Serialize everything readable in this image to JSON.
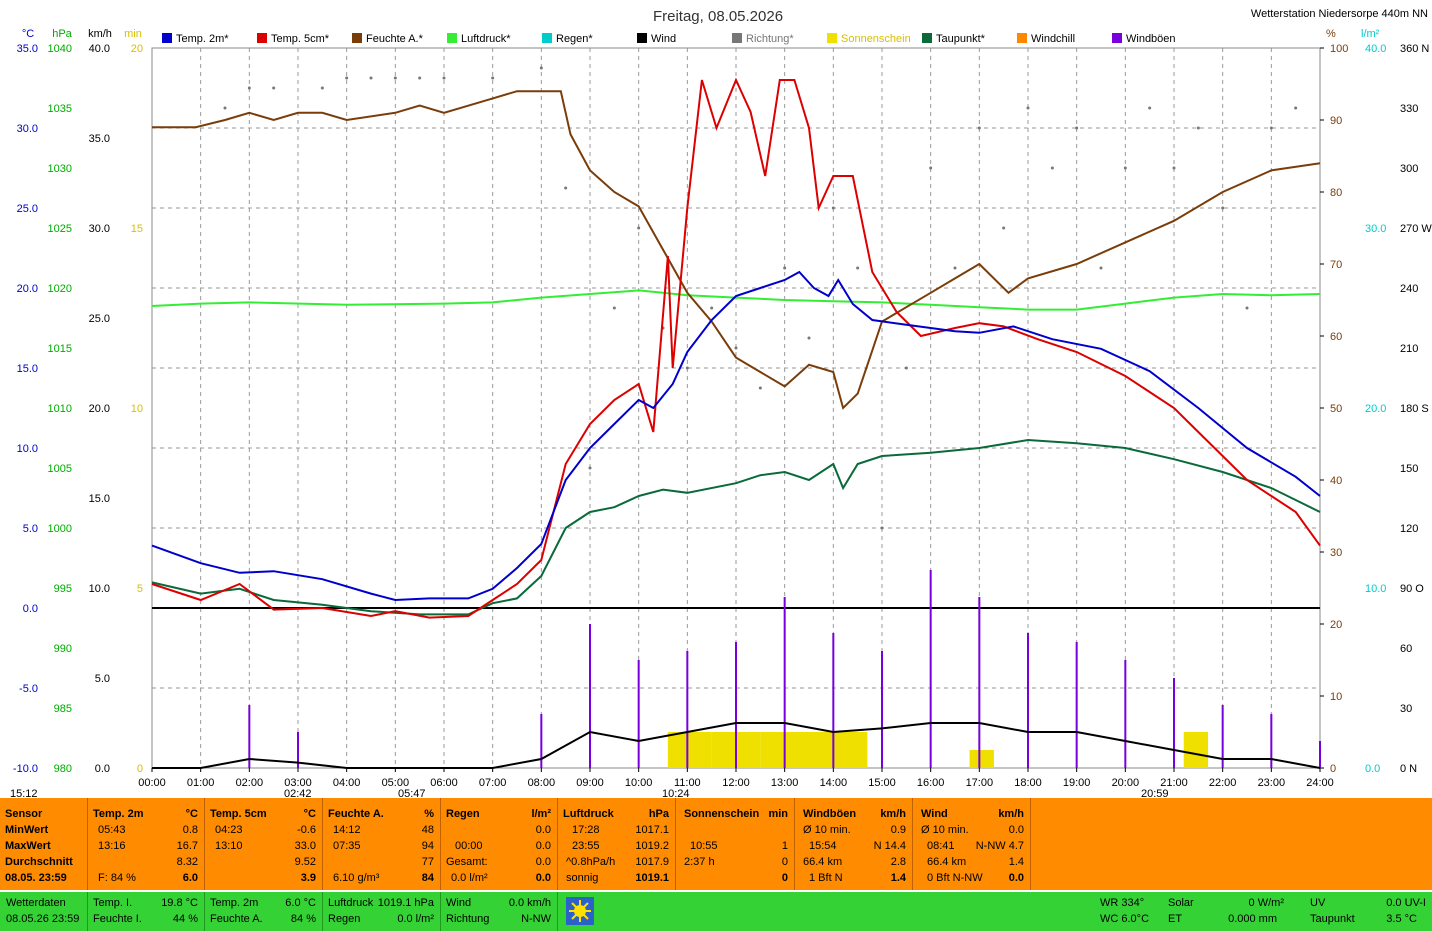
{
  "header": {
    "title": "Freitag, 08.05.2026",
    "station": "Wetterstation Niedersorpe 440m NN",
    "markers": {
      "start": "15:12",
      "min1": "02:42",
      "min2": "05:47",
      "noon": "10:24",
      "end": "20:59"
    }
  },
  "colors": {
    "temp2m": "#0000cc",
    "temp5cm": "#dd0000",
    "feuchte": "#7a3d0a",
    "luftdruck": "#33ee33",
    "regen": "#00cccc",
    "wind": "#000000",
    "richtung": "#777777",
    "sonne": "#f0e000",
    "taupunkt": "#0a6a3a",
    "windchill": "#ff8800",
    "windboeen": "#7700dd",
    "panel": "#ff8c00",
    "panel2": "#35d235"
  },
  "chart_data": {
    "type": "line",
    "title": "Freitag, 08.05.2026",
    "x_range": [
      0,
      24
    ],
    "x_tick_labels": [
      "00:00",
      "01:00",
      "02:00",
      "03:00",
      "04:00",
      "05:00",
      "06:00",
      "07:00",
      "08:00",
      "09:00",
      "10:00",
      "11:00",
      "12:00",
      "13:00",
      "14:00",
      "15:00",
      "16:00",
      "17:00",
      "18:00",
      "19:00",
      "20:00",
      "21:00",
      "22:00",
      "23:00",
      "24:00"
    ],
    "axes": {
      "left": [
        {
          "unit": "°C",
          "range": [
            -10,
            35
          ],
          "ticks": [
            "35.0",
            "30.0",
            "25.0",
            "20.0",
            "15.0",
            "10.0",
            "5.0",
            "0.0",
            "-5.0",
            "-10.0"
          ],
          "color": "#0000cc"
        },
        {
          "unit": "hPa",
          "range": [
            980,
            1040
          ],
          "ticks": [
            "1040",
            "1035",
            "1030",
            "1025",
            "1020",
            "1015",
            "1010",
            "1005",
            "1000",
            "995",
            "990",
            "985",
            "980"
          ],
          "color": "#00aa00"
        },
        {
          "unit": "km/h",
          "range": [
            0,
            40
          ],
          "ticks": [
            "40.0",
            "35.0",
            "30.0",
            "25.0",
            "20.0",
            "15.0",
            "10.0",
            "5.0",
            "0.0"
          ],
          "color": "#000000"
        },
        {
          "unit": "min",
          "range": [
            0,
            20
          ],
          "ticks": [
            "20",
            "15",
            "10",
            "5",
            "0"
          ],
          "color": "#d8c000"
        }
      ],
      "right": [
        {
          "unit": "%",
          "range": [
            0,
            100
          ],
          "ticks": [
            "100",
            "90",
            "80",
            "70",
            "60",
            "50",
            "40",
            "30",
            "20",
            "10",
            "0"
          ],
          "color": "#7a3d0a"
        },
        {
          "unit": "l/m²",
          "range": [
            0,
            40
          ],
          "ticks": [
            "40.0",
            "30.0",
            "20.0",
            "10.0",
            "0.0"
          ],
          "color": "#00cccc"
        },
        {
          "unit": "",
          "range": [
            0,
            360
          ],
          "ticks": [
            "360 N",
            "330",
            "300",
            "270 W",
            "240",
            "210",
            "180 S",
            "150",
            "120",
            "90 O",
            "60",
            "30",
            "0 N"
          ],
          "color": "#000000"
        }
      ]
    },
    "legend": [
      "Temp. 2m*",
      "Temp. 5cm*",
      "Feuchte A.*",
      "Luftdruck*",
      "Regen*",
      "Wind",
      "Richtung*",
      "Sonnenschein",
      "Taupunkt*",
      "Windchill",
      "Windböen"
    ],
    "series": [
      {
        "name": "Temp. 2m*",
        "unit": "°C",
        "x": [
          0,
          1,
          1.8,
          2.5,
          3.5,
          4.5,
          5.0,
          5.7,
          6.5,
          7.0,
          7.5,
          8.0,
          8.5,
          9.0,
          9.5,
          10.0,
          10.3,
          10.7,
          11.0,
          11.5,
          12.0,
          12.5,
          13.0,
          13.3,
          13.6,
          13.9,
          14.1,
          14.4,
          14.8,
          15.5,
          16.5,
          17.0,
          17.7,
          18.5,
          19.5,
          20.5,
          21.5,
          22.5,
          23.5,
          24.0
        ],
        "values": [
          3.9,
          2.8,
          2.2,
          2.3,
          1.8,
          0.9,
          0.5,
          0.6,
          0.6,
          1.2,
          2.5,
          4.0,
          8.0,
          10.0,
          11.5,
          13.0,
          12.5,
          14.0,
          16.0,
          18.0,
          19.5,
          20.0,
          20.5,
          21.0,
          20.0,
          19.5,
          20.5,
          19.0,
          18.0,
          17.7,
          17.3,
          17.2,
          17.6,
          16.8,
          16.2,
          14.8,
          12.5,
          10.0,
          8.2,
          7.0
        ]
      },
      {
        "name": "Temp. 5cm*",
        "unit": "°C",
        "x": [
          0,
          1,
          1.8,
          2.5,
          3.5,
          4.5,
          5.0,
          5.7,
          6.5,
          7.0,
          7.5,
          8.0,
          8.5,
          9.0,
          9.5,
          10.0,
          10.3,
          10.6,
          10.7,
          11.0,
          11.3,
          11.6,
          12.0,
          12.3,
          12.6,
          12.9,
          13.2,
          13.5,
          13.7,
          14.0,
          14.4,
          14.8,
          15.3,
          15.8,
          16.5,
          17.0,
          17.5,
          18.2,
          19.0,
          20.0,
          21.0,
          21.5,
          22.5,
          23.5,
          24.0
        ],
        "values": [
          1.5,
          0.5,
          1.5,
          -0.1,
          0.0,
          -0.5,
          -0.2,
          -0.6,
          -0.5,
          0.5,
          1.5,
          3.0,
          9.0,
          11.5,
          13.0,
          14.0,
          11.0,
          22.0,
          15.0,
          25.0,
          33.0,
          30.0,
          33.0,
          31.0,
          27.0,
          33.0,
          33.0,
          30.0,
          25.0,
          27.0,
          27.0,
          21.0,
          18.5,
          17.0,
          17.5,
          17.8,
          17.6,
          16.8,
          16.0,
          14.5,
          12.5,
          11.0,
          8.0,
          6.0,
          3.9
        ]
      },
      {
        "name": "Feuchte A.*",
        "unit": "%",
        "x": [
          0,
          0.9,
          1.5,
          2.0,
          2.5,
          3.0,
          3.5,
          4.0,
          5.0,
          5.5,
          6.0,
          7.0,
          7.5,
          8.0,
          8.4,
          8.6,
          9.0,
          9.5,
          10.0,
          10.5,
          11.0,
          11.5,
          12.0,
          12.5,
          13.0,
          13.5,
          14.0,
          14.2,
          14.5,
          14.8,
          15.0,
          15.5,
          16.0,
          16.5,
          17.0,
          17.6,
          18.0,
          19.0,
          20.0,
          21.0,
          22.0,
          23.0,
          24.0
        ],
        "values": [
          89,
          89,
          90,
          91,
          90,
          91,
          91,
          90,
          91,
          92,
          91,
          93,
          94,
          94,
          94,
          88,
          83,
          80,
          78,
          72,
          66,
          62,
          57,
          55,
          53,
          56,
          55,
          50,
          52,
          58,
          62,
          64,
          66,
          68,
          70,
          66,
          68,
          70,
          73,
          76,
          80,
          83,
          84
        ]
      },
      {
        "name": "Luftdruck*",
        "unit": "hPa",
        "x": [
          0,
          1,
          2,
          4,
          6,
          7,
          8,
          9,
          10,
          10.5,
          11,
          12,
          13,
          14,
          15,
          16,
          17,
          18,
          19,
          20,
          21,
          22,
          23,
          24
        ],
        "values": [
          1018.5,
          1018.7,
          1018.8,
          1018.6,
          1018.7,
          1018.8,
          1019.2,
          1019.5,
          1019.8,
          1019.6,
          1019.4,
          1019.2,
          1019.0,
          1018.9,
          1018.8,
          1018.6,
          1018.4,
          1018.2,
          1018.2,
          1018.7,
          1019.2,
          1019.5,
          1019.4,
          1019.5
        ]
      },
      {
        "name": "Taupunkt*",
        "unit": "°C",
        "x": [
          0,
          1,
          1.8,
          2.5,
          3.5,
          4.5,
          5.5,
          6.5,
          7.0,
          7.5,
          8.0,
          8.5,
          9.0,
          9.5,
          10.0,
          10.5,
          11.0,
          12.0,
          12.5,
          13.0,
          13.5,
          14.0,
          14.2,
          14.5,
          15.0,
          16.0,
          17.0,
          18.0,
          19.0,
          20.0,
          21.0,
          22.0,
          23.0,
          24.0
        ],
        "values": [
          1.6,
          0.9,
          1.2,
          0.5,
          0.2,
          -0.2,
          -0.4,
          -0.4,
          0.3,
          0.6,
          2.0,
          5.0,
          6.0,
          6.3,
          7.0,
          7.4,
          7.2,
          7.8,
          8.3,
          8.5,
          8.0,
          9.0,
          7.5,
          9.0,
          9.5,
          9.7,
          10.0,
          10.5,
          10.3,
          10.0,
          9.3,
          8.5,
          7.5,
          6.0
        ]
      },
      {
        "name": "Wind",
        "unit": "km/h",
        "x": [
          0,
          1,
          2,
          3,
          4,
          5,
          6,
          7,
          8,
          9,
          10,
          11,
          12,
          13,
          14,
          15,
          16,
          17,
          18,
          19,
          20,
          21,
          22,
          23,
          24
        ],
        "values": [
          0.0,
          0.0,
          0.5,
          0.3,
          0.0,
          0.0,
          0.0,
          0.0,
          0.5,
          2.0,
          1.5,
          2.0,
          2.5,
          2.5,
          2.0,
          2.2,
          2.5,
          2.5,
          2.0,
          2.0,
          1.5,
          1.0,
          0.5,
          0.5,
          0.0
        ]
      },
      {
        "name": "Windböen",
        "unit": "km/h",
        "x": [
          0,
          1,
          2,
          3,
          4,
          5,
          6,
          7,
          8,
          9,
          10,
          11,
          12,
          13,
          14,
          15,
          16,
          17,
          18,
          19,
          20,
          21,
          22,
          23,
          24
        ],
        "values": [
          0.0,
          0.0,
          3.5,
          2.0,
          0.0,
          0.0,
          0.0,
          0.0,
          3.0,
          8.0,
          6.0,
          6.5,
          7.0,
          9.5,
          7.5,
          6.5,
          11.0,
          9.5,
          7.5,
          7.0,
          6.0,
          5.0,
          3.5,
          3.0,
          1.5
        ]
      },
      {
        "name": "Sonnenschein",
        "unit": "min",
        "x": [
          10.6,
          11.0,
          11.5,
          12.0,
          12.5,
          13.0,
          13.5,
          13.9,
          14.0,
          14.2,
          16.8,
          21.2
        ],
        "values": [
          1.0,
          1.0,
          1.0,
          1.0,
          1.0,
          1.0,
          1.0,
          1.0,
          1.0,
          1.0,
          0.5,
          1.0
        ]
      },
      {
        "name": "Richtung*",
        "unit": "°",
        "x": [
          1.5,
          2.0,
          2.5,
          3.5,
          4.0,
          4.5,
          5.0,
          5.5,
          6.0,
          7.0,
          8.0,
          8.5,
          9.0,
          9.5,
          10.0,
          10.5,
          11.0,
          11.5,
          12.0,
          12.5,
          13.0,
          13.5,
          14.0,
          14.5,
          15.0,
          15.5,
          16.0,
          16.5,
          17.0,
          17.5,
          18.0,
          18.5,
          19.0,
          19.5,
          20.0,
          20.5,
          21.0,
          21.5,
          22.0,
          22.5,
          23.0,
          23.5
        ],
        "values": [
          330,
          340,
          340,
          340,
          345,
          345,
          345,
          345,
          345,
          345,
          350,
          290,
          150,
          230,
          270,
          220,
          200,
          230,
          210,
          190,
          250,
          215,
          280,
          250,
          120,
          200,
          300,
          250,
          320,
          270,
          330,
          300,
          320,
          250,
          300,
          330,
          300,
          320,
          280,
          230,
          320,
          330
        ]
      }
    ]
  },
  "panel": {
    "sensor": {
      "title": "Sensor",
      "rows": [
        "MinWert",
        "MaxWert",
        "Durchschnitt",
        "08.05. 23:59"
      ]
    },
    "temp2m": {
      "title": "Temp. 2m",
      "unit": "°C",
      "min_time": "05:43",
      "min": "0.8",
      "max_time": "13:16",
      "max": "16.7",
      "avg": "8.32",
      "humidity_label": "F: 84 %",
      "current": "6.0"
    },
    "temp5cm": {
      "title": "Temp. 5cm",
      "unit": "°C",
      "min_time": "04:23",
      "min": "-0.6",
      "max_time": "13:10",
      "max": "33.0",
      "avg": "9.52",
      "current": "3.9"
    },
    "feuchte": {
      "title": "Feuchte A.",
      "unit": "%",
      "min_time": "14:12",
      "min": "48",
      "max_time": "07:35",
      "max": "94",
      "avg": "77",
      "abs": "6.10 g/m³",
      "current": "84"
    },
    "regen": {
      "title": "Regen",
      "unit": "l/m²",
      "r1_label": "",
      "r1": "0.0",
      "r2_label": "00:00",
      "r2": "0.0",
      "r3_label": "Gesamt:",
      "r3": "0.0",
      "r4_label": "0.0 l/m²",
      "r4": "0.0"
    },
    "luftdruck": {
      "title": "Luftdruck",
      "unit": "hPa",
      "min_time": "17:28",
      "min": "1017.1",
      "max_time": "23:55",
      "max": "1019.2",
      "trend_label": "^0.8hPa/h",
      "trend": "1017.9",
      "state": "sonnig",
      "current": "1019.1"
    },
    "sonnenschein": {
      "title": "Sonnenschein",
      "unit": "min",
      "r1_label": "",
      "r1": "",
      "r2_label": "10:55",
      "r2": "1",
      "r3_label": "2:37 h",
      "r3": "0",
      "r4_label": "",
      "r4": "0"
    },
    "windboeen": {
      "title": "Windböen",
      "unit": "km/h",
      "r1_label": "Ø 10 min.",
      "r1": "0.9",
      "r2_label": "15:54",
      "r2": "N 14.4",
      "r3_label": "66.4 km",
      "r3": "2.8",
      "r4_label": "1 Bft N",
      "r4": "1.4"
    },
    "wind": {
      "title": "Wind",
      "unit": "km/h",
      "r1_label": "Ø 10 min.",
      "r1": "0.0",
      "r2_label": "08:41",
      "r2": "N-NW 4.7",
      "r3_label": "66.4 km",
      "r3": "1.4",
      "r4_label": "0 Bft N-NW",
      "r4": "0.0"
    }
  },
  "bottom": {
    "label": "Wetterdaten",
    "datetime": "08.05.26 23:59",
    "temp_i_label": "Temp. I.",
    "temp_i": "19.8 °C",
    "feuchte_i_label": "Feuchte I.",
    "feuchte_i": "44 %",
    "temp2m_label": "Temp. 2m",
    "temp2m": "6.0 °C",
    "feuchte_a_label": "Feuchte A.",
    "feuchte_a": "84 %",
    "luftdruck_label": "Luftdruck",
    "luftdruck": "1019.1 hPa",
    "regen_label": "Regen",
    "regen": "0.0 l/m²",
    "wind_label": "Wind",
    "wind": "0.0 km/h",
    "richtung_label": "Richtung",
    "richtung": "N-NW",
    "wr": "WR 334°",
    "wc": "WC 6.0°C",
    "solar_label": "Solar",
    "solar": "0 W/m²",
    "et_label": "ET",
    "et": "0.000 mm",
    "uv_label": "UV",
    "uv": "0.0 UV-I",
    "taupunkt_label": "Taupunkt",
    "taupunkt": "3.5 °C"
  }
}
